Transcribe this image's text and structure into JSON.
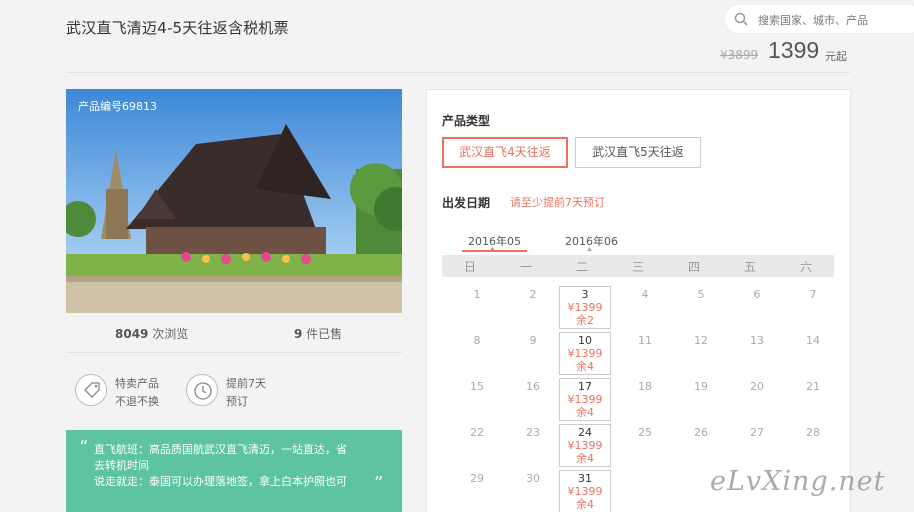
{
  "header": {
    "title": "武汉直飞清迈4-5天往返含税机票",
    "search_placeholder": "搜索国家、城市、产品",
    "old_price": "¥3899",
    "price": "1399",
    "price_unit": "元起"
  },
  "product": {
    "id_label": "产品编号69813",
    "views_count": "8049",
    "views_label": " 次浏览",
    "sold_count": "9",
    "sold_label": " 件已售",
    "features": [
      {
        "line1": "特卖产品",
        "line2": "不退不换",
        "icon": "tag-icon"
      },
      {
        "line1": "提前7天",
        "line2": "预订",
        "icon": "clock-icon"
      }
    ],
    "notice_line1": "直飞航班：高品质国航武汉直飞清迈，一站直达，省",
    "notice_line2": "去转机时间",
    "notice_line3": "说走就走：泰国可以办理落地签，拿上白本护照也可"
  },
  "booking": {
    "type_label": "产品类型",
    "options": [
      "武汉直飞4天往返",
      "武汉直飞5天往返"
    ],
    "selected_option": 0,
    "date_label": "出发日期",
    "date_hint": "请至少提前7天预订",
    "months": [
      "2016年05",
      "2016年06"
    ],
    "active_month": 0,
    "weekdays": [
      "日",
      "一",
      "二",
      "三",
      "四",
      "五",
      "六"
    ],
    "rows": [
      [
        "1",
        "2",
        "3",
        "4",
        "5",
        "6",
        "7"
      ],
      [
        "8",
        "9",
        "10",
        "11",
        "12",
        "13",
        "14"
      ],
      [
        "15",
        "16",
        "17",
        "18",
        "19",
        "20",
        "21"
      ],
      [
        "22",
        "23",
        "24",
        "25",
        "26",
        "27",
        "28"
      ],
      [
        "29",
        "30",
        "31"
      ]
    ],
    "available": [
      {
        "day": "3",
        "price": "¥1399",
        "remain": "余2"
      },
      {
        "day": "10",
        "price": "¥1399",
        "remain": "余4"
      },
      {
        "day": "17",
        "price": "¥1399",
        "remain": "余4"
      },
      {
        "day": "24",
        "price": "¥1399",
        "remain": "余4"
      },
      {
        "day": "31",
        "price": "¥1399",
        "remain": "余4"
      }
    ]
  },
  "watermark": "eLvXing.net",
  "colors": {
    "accent": "#e9735f",
    "notice_bg": "#5dc3a3"
  }
}
